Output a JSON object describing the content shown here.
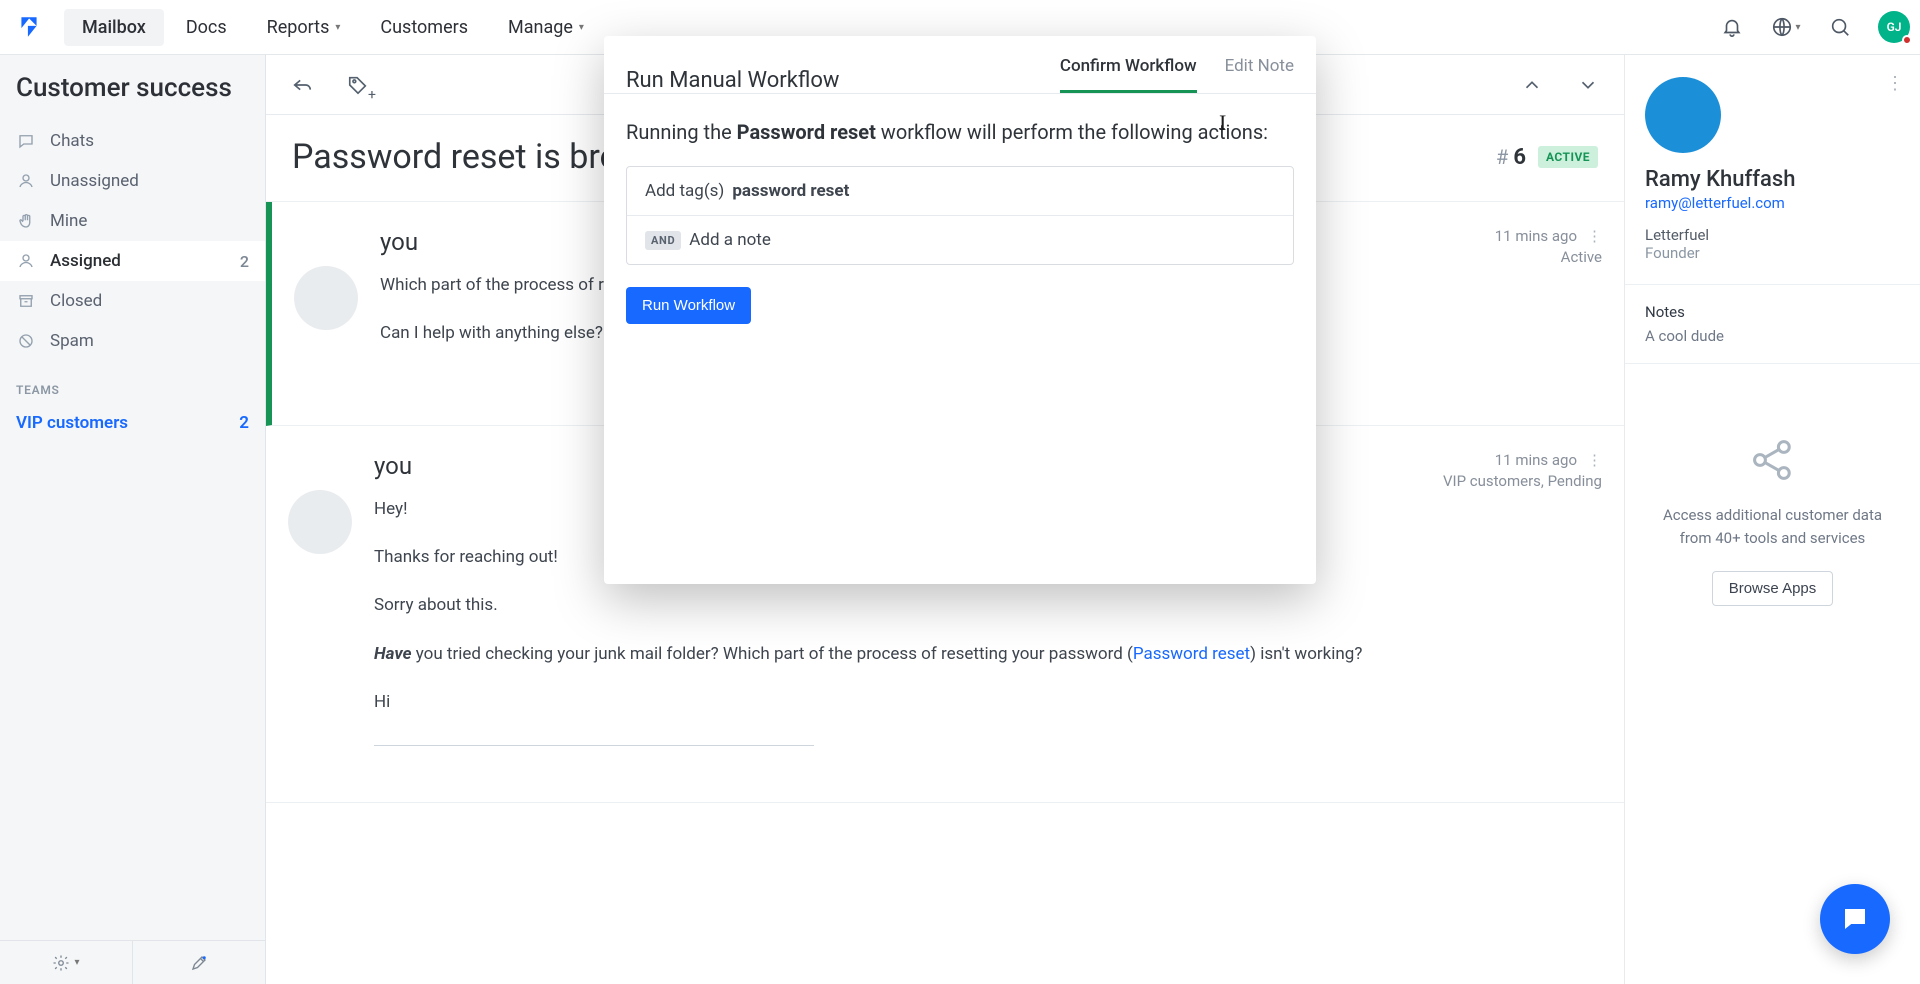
{
  "nav": {
    "items": [
      "Mailbox",
      "Docs",
      "Reports",
      "Customers",
      "Manage"
    ],
    "avatar_initials": "GJ"
  },
  "sidebar": {
    "title": "Customer success",
    "items": [
      {
        "label": "Chats",
        "icon": "chat"
      },
      {
        "label": "Unassigned",
        "icon": "user"
      },
      {
        "label": "Mine",
        "icon": "hand"
      },
      {
        "label": "Assigned",
        "icon": "user",
        "count": "2",
        "active": true
      },
      {
        "label": "Closed",
        "icon": "archive"
      },
      {
        "label": "Spam",
        "icon": "ban"
      }
    ],
    "teams_label": "TEAMS",
    "team": {
      "label": "VIP customers",
      "count": "2"
    }
  },
  "conversation": {
    "subject": "Password reset is broken",
    "number_prefix": "#",
    "number": "6",
    "status": "ACTIVE"
  },
  "messages": [
    {
      "from": "you",
      "time": "11 mins ago",
      "meta": "Active",
      "paragraphs": [
        "Which part of the process of resetting your password isn't working?",
        "Can I help with anything else?"
      ]
    },
    {
      "from": "you",
      "time": "11 mins ago",
      "meta": "VIP customers, Pending",
      "paragraphs": [
        "Hey!",
        "Thanks for reaching out!",
        "Sorry about this."
      ],
      "rich_line": {
        "have": "Have",
        "after_have": " you tried checking your junk mail folder? Which part of the process of resetting your password (",
        "link": "Password reset",
        "after_link": ") isn't working?"
      },
      "trailer": "Hi"
    }
  ],
  "profile": {
    "name": "Ramy Khuffash",
    "email": "ramy@letterfuel.com",
    "org": "Letterfuel",
    "role": "Founder",
    "notes_label": "Notes",
    "notes_text": "A cool dude"
  },
  "apps": {
    "line1": "Access additional customer data",
    "line2": "from 40+ tools and services",
    "button": "Browse Apps"
  },
  "modal": {
    "title": "Run Manual Workflow",
    "tab_confirm": "Confirm Workflow",
    "tab_edit": "Edit Note",
    "sentence_pre": "Running the ",
    "sentence_bold": "Password reset",
    "sentence_post": " workflow will perform the following actions:",
    "row1_pre": "Add tag(s) ",
    "row1_bold": "password reset",
    "row2_tag": "AND",
    "row2_text": " Add a note",
    "run_button": "Run Workflow"
  }
}
